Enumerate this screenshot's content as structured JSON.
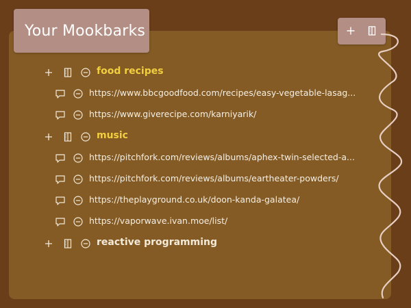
{
  "header": {
    "title": "Your Mookbarks"
  },
  "toolbar": {
    "add_icon": "plus-icon",
    "split_icon": "split-column-icon"
  },
  "folders": [
    {
      "name": "food recipes",
      "color": "#f2cf3e",
      "links": [
        "https://www.bbcgoodfood.com/recipes/easy-vegetable-lasag...",
        "https://www.giverecipe.com/karniyarik/"
      ]
    },
    {
      "name": "music",
      "color": "#f2cf3e",
      "links": [
        "https://pitchfork.com/reviews/albums/aphex-twin-selected-a...",
        "https://pitchfork.com/reviews/albums/eartheater-powders/",
        "https://theplayground.co.uk/doon-kanda-galatea/",
        "https://vaporwave.ivan.moe/list/"
      ]
    },
    {
      "name": "reactive programming",
      "color": "#f3ead9",
      "links": []
    }
  ],
  "colors": {
    "background": "#6a3e19",
    "panel": "#845b25",
    "header_box": "#b28e84",
    "folder_highlight": "#f2cf3e",
    "text": "#f3ead9"
  }
}
